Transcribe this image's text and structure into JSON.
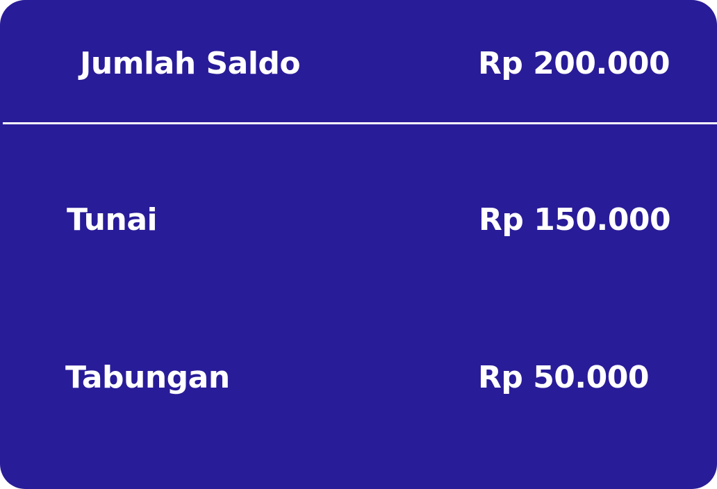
{
  "summary": {
    "total": {
      "label": "Jumlah Saldo",
      "amount": "Rp 200.000"
    },
    "items": [
      {
        "label": "Tunai",
        "amount": "Rp 150.000"
      },
      {
        "label": "Tabungan",
        "amount": "Rp 50.000"
      }
    ]
  },
  "colors": {
    "card_background": "#291c98",
    "text": "#ffffff",
    "divider": "#ffffff"
  }
}
